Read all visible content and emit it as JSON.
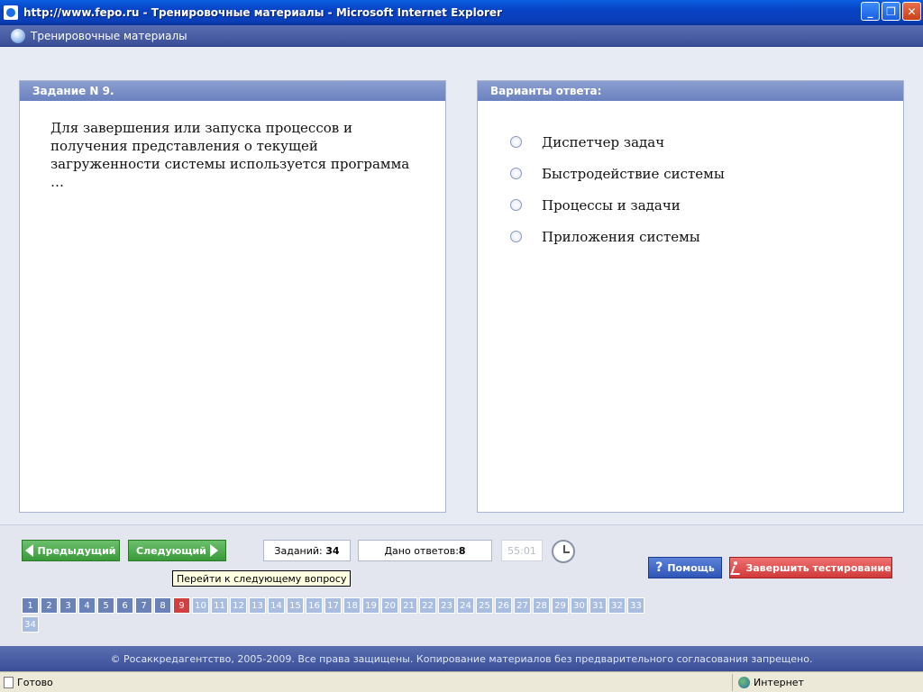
{
  "window": {
    "title": "http://www.fepo.ru - Тренировочные материалы - Microsoft Internet Explorer",
    "minimize": "_",
    "maximize": "❐",
    "close": "✕"
  },
  "app": {
    "title": "Тренировочные материалы"
  },
  "question_panel": {
    "header": "Задание N 9.",
    "text": "Для завершения или запуска процессов и получения представления о текущей загруженности системы используется программа …"
  },
  "answers_panel": {
    "header": "Варианты ответа:",
    "options": [
      {
        "label": "Диспетчер задач",
        "selected": false
      },
      {
        "label": "Быстродействие системы",
        "selected": false
      },
      {
        "label": "Процессы и задачи",
        "selected": false
      },
      {
        "label": "Приложения системы",
        "selected": false
      }
    ]
  },
  "navigation": {
    "prev_label": "Предыдущий",
    "next_label": "Следующий",
    "tasks_label": "Заданий:",
    "tasks_count": "34",
    "answers_label": "Дано ответов:",
    "answers_count": "8",
    "timer": "55:01",
    "tooltip": "Перейти к следующему вопросу",
    "help_label": "Помощь",
    "finish_label": "Завершить тестирование",
    "current_question": 9,
    "total_questions": 34,
    "answered_through": 8
  },
  "footer": {
    "text": "© Росаккредагентство, 2005-2009. Все права защищены. Копирование материалов без предварительного согласования запрещено."
  },
  "statusbar": {
    "ready": "Готово",
    "zone": "Интернет"
  },
  "colors": {
    "answered": "#6a82b8",
    "current": "#d04040",
    "pending": "#a8bde0"
  }
}
